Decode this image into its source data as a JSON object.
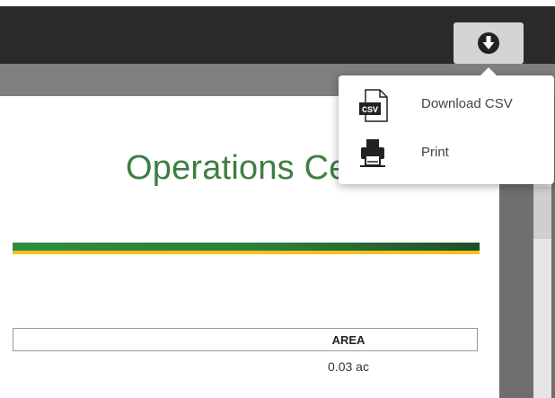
{
  "toolbar": {
    "download_icon": "download-circle-arrow-icon"
  },
  "document": {
    "title": "Operations Center",
    "banner_colors": {
      "green": "#2f8c3e",
      "dark_green": "#1f4f2b",
      "yellow": "#f5c11a"
    },
    "table": {
      "header": "AREA",
      "rows": [
        "0.03 ac"
      ]
    }
  },
  "menu": {
    "items": [
      {
        "label": "Download CSV",
        "icon": "csv-file-icon",
        "icon_text": "CSV"
      },
      {
        "label": "Print",
        "icon": "printer-icon"
      }
    ]
  },
  "colors": {
    "topbar": "#2a2a2a",
    "title_green": "#3e7e43",
    "button_bg": "#d4d4d4"
  }
}
